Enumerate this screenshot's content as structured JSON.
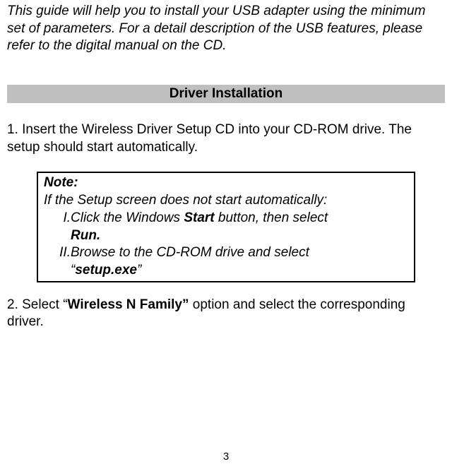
{
  "intro": "This guide will help you to install your USB adapter using the minimum set of parameters.  For a detail description of the USB features, please refer to the digital manual on the CD.",
  "section_heading": "Driver Installation",
  "step1": "1. Insert the Wireless Driver Setup CD into your CD-ROM drive. The setup should start automatically.",
  "note": {
    "title": "Note:",
    "line1": "If the Setup screen does not start automatically:",
    "item1_num": " I.",
    "item1_a": "Click the Windows ",
    "item1_b": "Start",
    "item1_c": " button, then select ",
    "item1_d": "Run.",
    "item2_num": "II.",
    "item2_a": "Browse to the CD-ROM drive and select",
    "item2_b_open": "“",
    "item2_b": "setup.exe",
    "item2_b_close": "”"
  },
  "step2_a": "2. Select “",
  "step2_b": "Wireless N Family”",
  "step2_c": " option and select the corresponding driver.",
  "page_number": "3"
}
